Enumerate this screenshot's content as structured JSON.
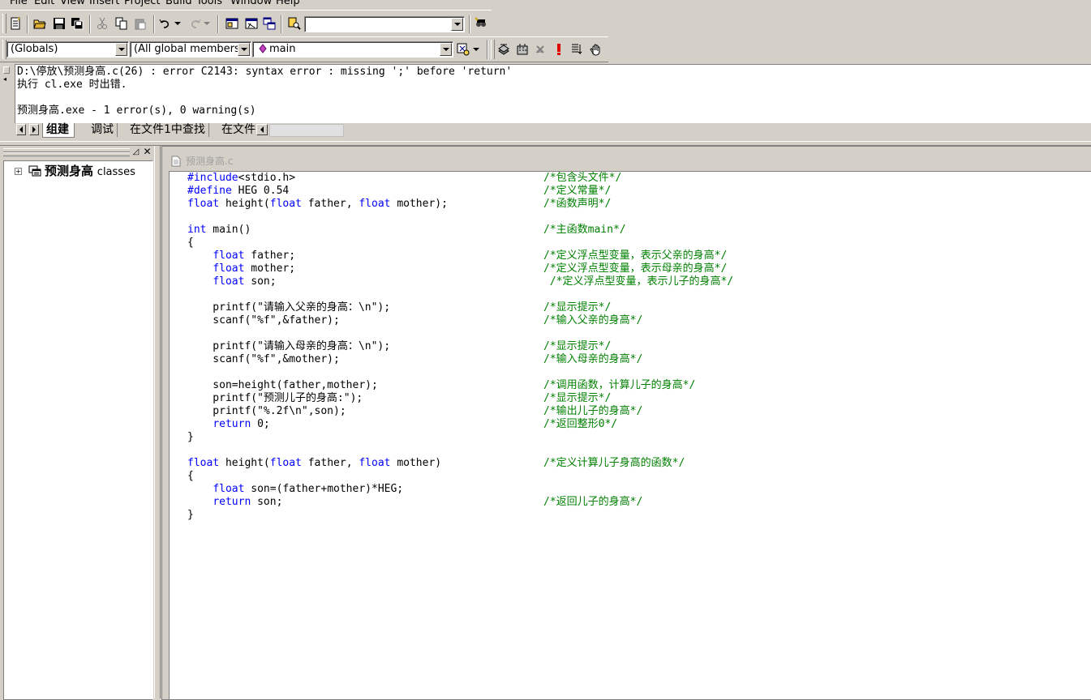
{
  "menu": [
    "File",
    "Edit",
    "View",
    "Insert",
    "Project",
    "Build",
    "Tools",
    "Window",
    "Help"
  ],
  "combos": {
    "find_value": "",
    "scope": "(Globals)",
    "members": "(All global members",
    "function": "main"
  },
  "output": {
    "lines": [
      "D:\\停放\\预测身高.c(26) : error C2143: syntax error : missing ';' before 'return'",
      "执行 cl.exe 时出错.",
      "",
      "预测身高.exe - 1 error(s), 0 warning(s)"
    ],
    "tabs": [
      "组建",
      "调试",
      "在文件1中查找",
      "在文件"
    ]
  },
  "workspace": {
    "root_label": "预测身高",
    "root_suffix": "classes"
  },
  "editor": {
    "filename": "预测身高.c",
    "code_lines": [
      {
        "tokens": [
          {
            "t": "#include",
            "k": 1
          },
          {
            "t": "<stdio.h>"
          }
        ],
        "comment": "/*包含头文件*/"
      },
      {
        "tokens": [
          {
            "t": "#define",
            "k": 1
          },
          {
            "t": " HEG 0.54"
          }
        ],
        "comment": "/*定义常量*/"
      },
      {
        "tokens": [
          {
            "t": "float",
            "k": 1
          },
          {
            "t": " height("
          },
          {
            "t": "float",
            "k": 1
          },
          {
            "t": " father, "
          },
          {
            "t": "float",
            "k": 1
          },
          {
            "t": " mother);"
          }
        ],
        "comment": "/*函数声明*/"
      },
      {
        "tokens": [],
        "comment": ""
      },
      {
        "tokens": [
          {
            "t": "int",
            "k": 1
          },
          {
            "t": " main()"
          }
        ],
        "comment": "/*主函数main*/"
      },
      {
        "tokens": [
          {
            "t": "{"
          }
        ],
        "comment": ""
      },
      {
        "tokens": [
          {
            "t": "    "
          },
          {
            "t": "float",
            "k": 1
          },
          {
            "t": " father;"
          }
        ],
        "comment": "/*定义浮点型变量，表示父亲的身高*/"
      },
      {
        "tokens": [
          {
            "t": "    "
          },
          {
            "t": "float",
            "k": 1
          },
          {
            "t": " mother;"
          }
        ],
        "comment": "/*定义浮点型变量，表示母亲的身高*/"
      },
      {
        "tokens": [
          {
            "t": "    "
          },
          {
            "t": "float",
            "k": 1
          },
          {
            "t": " son;"
          }
        ],
        "comment": " /*定义浮点型变量，表示儿子的身高*/"
      },
      {
        "tokens": [],
        "comment": ""
      },
      {
        "tokens": [
          {
            "t": "    printf(\"请输入父亲的身高：\\n\");"
          }
        ],
        "comment": "/*显示提示*/"
      },
      {
        "tokens": [
          {
            "t": "    scanf(\"%f\",&father);"
          }
        ],
        "comment": "/*输入父亲的身高*/"
      },
      {
        "tokens": [],
        "comment": ""
      },
      {
        "tokens": [
          {
            "t": "    printf(\"请输入母亲的身高：\\n\");"
          }
        ],
        "comment": "/*显示提示*/"
      },
      {
        "tokens": [
          {
            "t": "    scanf(\"%f\",&mother);"
          }
        ],
        "comment": "/*输入母亲的身高*/"
      },
      {
        "tokens": [],
        "comment": ""
      },
      {
        "tokens": [
          {
            "t": "    son=height(father,mother);"
          }
        ],
        "comment": "/*调用函数，计算儿子的身高*/"
      },
      {
        "tokens": [
          {
            "t": "    printf(\"预测儿子的身高:\");"
          }
        ],
        "comment": "/*显示提示*/"
      },
      {
        "tokens": [
          {
            "t": "    printf(\"%.2f\\n\",son);"
          }
        ],
        "comment": "/*输出儿子的身高*/"
      },
      {
        "tokens": [
          {
            "t": "    "
          },
          {
            "t": "return",
            "k": 1
          },
          {
            "t": " 0;"
          }
        ],
        "comment": "/*返回整形0*/"
      },
      {
        "tokens": [
          {
            "t": "}"
          }
        ],
        "comment": ""
      },
      {
        "tokens": [],
        "comment": ""
      },
      {
        "tokens": [
          {
            "t": "float",
            "k": 1
          },
          {
            "t": " height("
          },
          {
            "t": "float",
            "k": 1
          },
          {
            "t": " father, "
          },
          {
            "t": "float",
            "k": 1
          },
          {
            "t": " mother)"
          }
        ],
        "comment": "/*定义计算儿子身高的函数*/"
      },
      {
        "tokens": [
          {
            "t": "{"
          }
        ],
        "comment": ""
      },
      {
        "tokens": [
          {
            "t": "    "
          },
          {
            "t": "float",
            "k": 1
          },
          {
            "t": " son=(father+mother)*HEG;"
          }
        ],
        "comment": ""
      },
      {
        "tokens": [
          {
            "t": "    "
          },
          {
            "t": "return",
            "k": 1
          },
          {
            "t": " son;"
          }
        ],
        "comment": "/*返回儿子的身高*/"
      },
      {
        "tokens": [
          {
            "t": "}"
          }
        ],
        "comment": ""
      }
    ]
  },
  "colors": {
    "keyword": "#0000ff",
    "comment": "#008000",
    "face": "#d4d0c8"
  }
}
